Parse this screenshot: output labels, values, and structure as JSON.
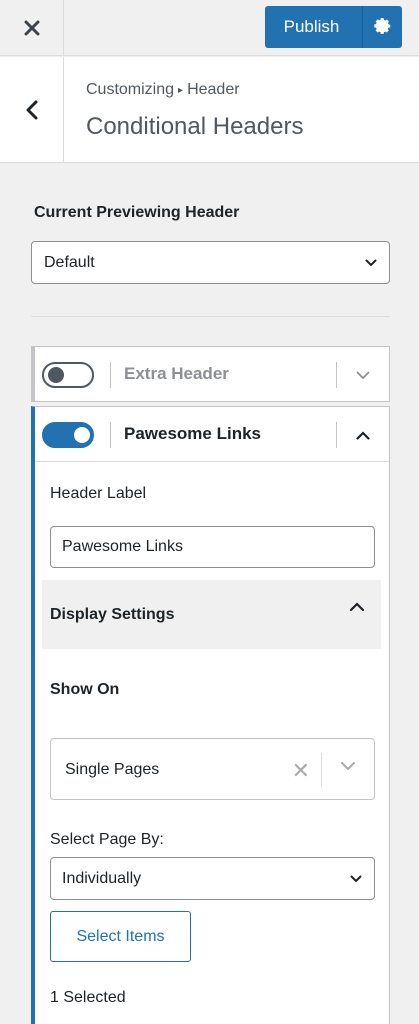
{
  "topbar": {
    "close_icon": "close-icon",
    "publish_label": "Publish",
    "gear_icon": "gear-icon"
  },
  "title": {
    "breadcrumb_root": "Customizing",
    "breadcrumb_separator": "▸",
    "breadcrumb_current": "Header",
    "panel_title": "Conditional Headers"
  },
  "preview": {
    "label": "Current Previewing Header",
    "selected": "Default"
  },
  "headers": [
    {
      "title": "Extra Header",
      "enabled": false,
      "expanded": false
    },
    {
      "title": "Pawesome Links",
      "enabled": true,
      "expanded": true
    }
  ],
  "editor": {
    "header_label_caption": "Header Label",
    "header_label_value": "Pawesome Links",
    "display_settings_label": "Display Settings",
    "show_on_label": "Show On",
    "show_on_value": "Single Pages",
    "select_page_by_label": "Select Page By:",
    "select_page_by_value": "Individually",
    "select_items_button": "Select Items",
    "selected_count": "1 Selected"
  },
  "colors": {
    "accent": "#2271b1",
    "background": "#f0f0f1",
    "border": "#c3c4c7"
  }
}
